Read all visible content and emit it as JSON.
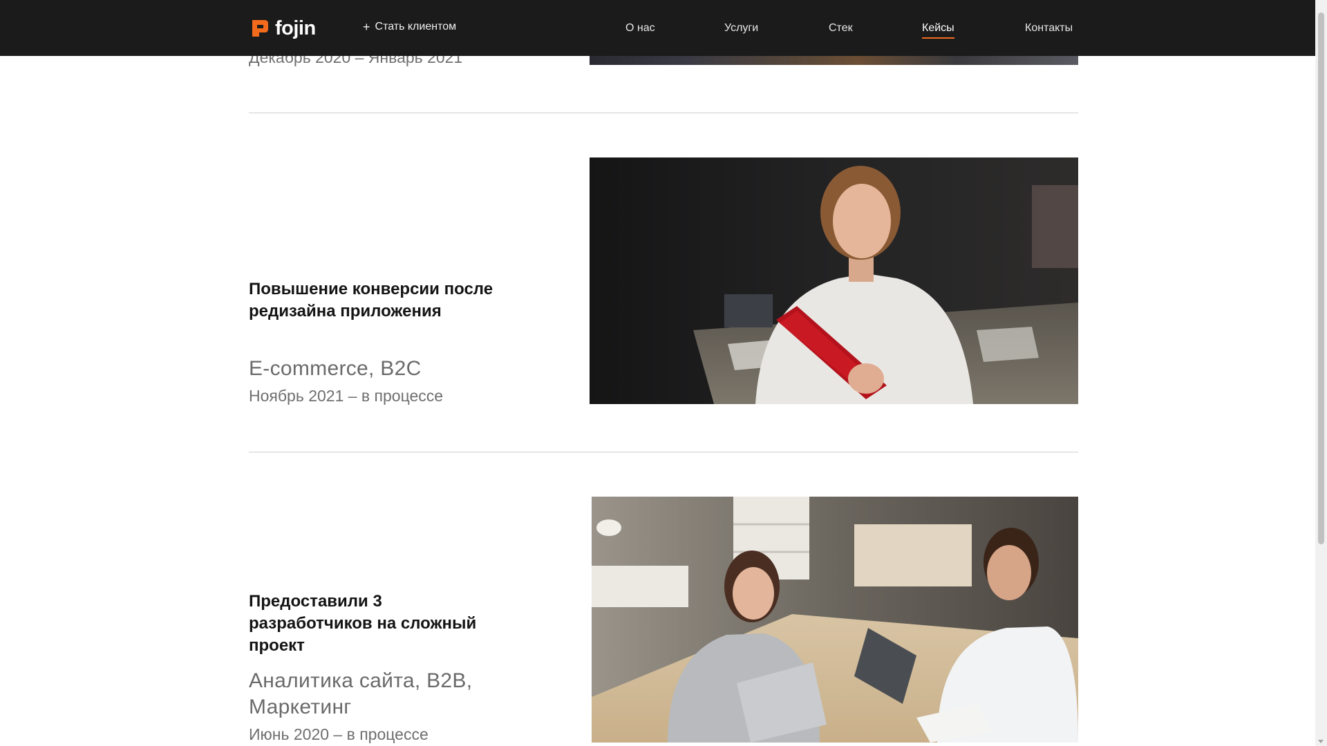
{
  "header": {
    "logo_text": "fojin",
    "cta_label": "Стать клиентом",
    "nav": [
      "О нас",
      "Услуги",
      "Стек",
      "Кейсы",
      "Контакты"
    ],
    "active_nav": "Кейсы",
    "accent_color": "#f26b1d",
    "background_color": "#1b1b1b"
  },
  "cases": [
    {
      "dates": "Декабрь 2020 – Январь 2021"
    },
    {
      "title": "Повышение конверсии после редизайна приложения",
      "tags": "E-commerce, B2C",
      "dates": "Ноябрь 2021 – в процессе",
      "photo": "woman-holding-red-laptop-in-office"
    },
    {
      "title": "Предоставили 3 разработчиков на сложный проект",
      "tags": "Аналитика сайта, B2B, Маркетинг",
      "dates": "Июнь 2020 – в процессе",
      "photo": "two-developers-at-laptops-in-office"
    }
  ]
}
